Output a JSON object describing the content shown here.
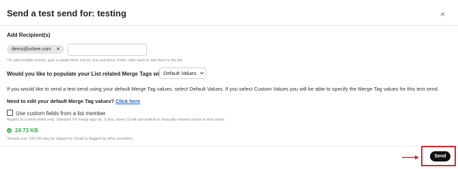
{
  "dialog": {
    "title": "Send a test send for: testing",
    "close_symbol": "×"
  },
  "recipients": {
    "label": "Add Recipient(s)",
    "chips": [
      {
        "email": "demo@orbee.com",
        "remove_symbol": "×"
      }
    ],
    "input_value": "",
    "help": "*To add multiple emails, type or paste them one by one and press 'Enter' after each to add them to the list."
  },
  "merge_tags": {
    "question": "Would you like to populate your List related Merge Tags with:",
    "selected_option": "Default Values",
    "description": "If you would like to send a test send using your default Merge Tag values, select Default Values. If you select Custom Values you will be able to specify the Merge Tag values for this test send.",
    "edit_prompt": "Need to edit your default Merge Tag values?",
    "edit_link": "Click here"
  },
  "custom_fields": {
    "checkbox_label": "Use custom fields from a list member",
    "checked": false,
    "help": "Applies to custom fields only. Standard PII merge tags (ie. {{ first_name }}) will use default or manually entered values in test sends."
  },
  "email_size": {
    "value": "24.73 KB",
    "note": "*Emails over 100 KB may be clipped by Gmail or flagged by other providers."
  },
  "footer": {
    "send_label": "Send"
  },
  "colors": {
    "highlight": "#d8262a",
    "success": "#2fb34a",
    "link": "#1a5fc8",
    "send_bg": "#111111"
  }
}
